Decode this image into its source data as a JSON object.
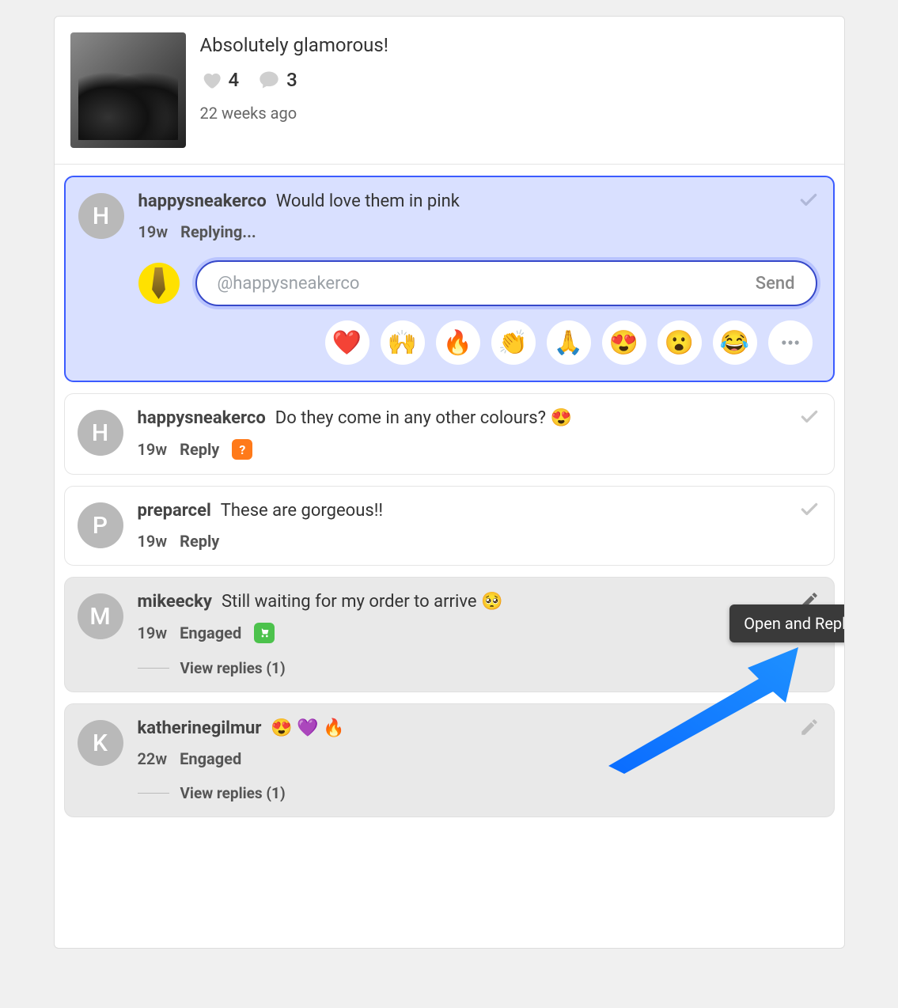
{
  "post": {
    "caption": "Absolutely glamorous!",
    "likes": "4",
    "comments_count": "3",
    "age": "22 weeks ago"
  },
  "compose": {
    "mention": "@happysneakerco",
    "send_label": "Send"
  },
  "emoji_buttons": [
    "❤️",
    "🙌",
    "🔥",
    "👏",
    "🙏",
    "😍",
    "😮",
    "😂"
  ],
  "tooltip": {
    "open_reply": "Open and Reply"
  },
  "comments": [
    {
      "avatar_letter": "H",
      "username": "happysneakerco",
      "text": "Would love them in pink",
      "age": "19w",
      "status": "Replying...",
      "active_compose": true,
      "check": true
    },
    {
      "avatar_letter": "H",
      "username": "happysneakerco",
      "text": "Do they come in any other colours? 😍",
      "age": "19w",
      "status": "Reply",
      "tag": "?",
      "tag_color": "orange",
      "check": true
    },
    {
      "avatar_letter": "P",
      "username": "preparcel",
      "text": "These are gorgeous!!",
      "age": "19w",
      "status": "Reply",
      "check": true
    },
    {
      "avatar_letter": "M",
      "username": "mikeecky",
      "text": "Still waiting for my order to arrive 🥺",
      "age": "19w",
      "status": "Engaged",
      "tag": "cart",
      "tag_color": "green",
      "muted": true,
      "pencil": true,
      "pencil_active": true,
      "view_replies": "View replies (1)"
    },
    {
      "avatar_letter": "K",
      "username": "katherinegilmur",
      "text": "😍 💜 🔥",
      "age": "22w",
      "status": "Engaged",
      "muted": true,
      "pencil": true,
      "view_replies": "View replies (1)"
    }
  ]
}
